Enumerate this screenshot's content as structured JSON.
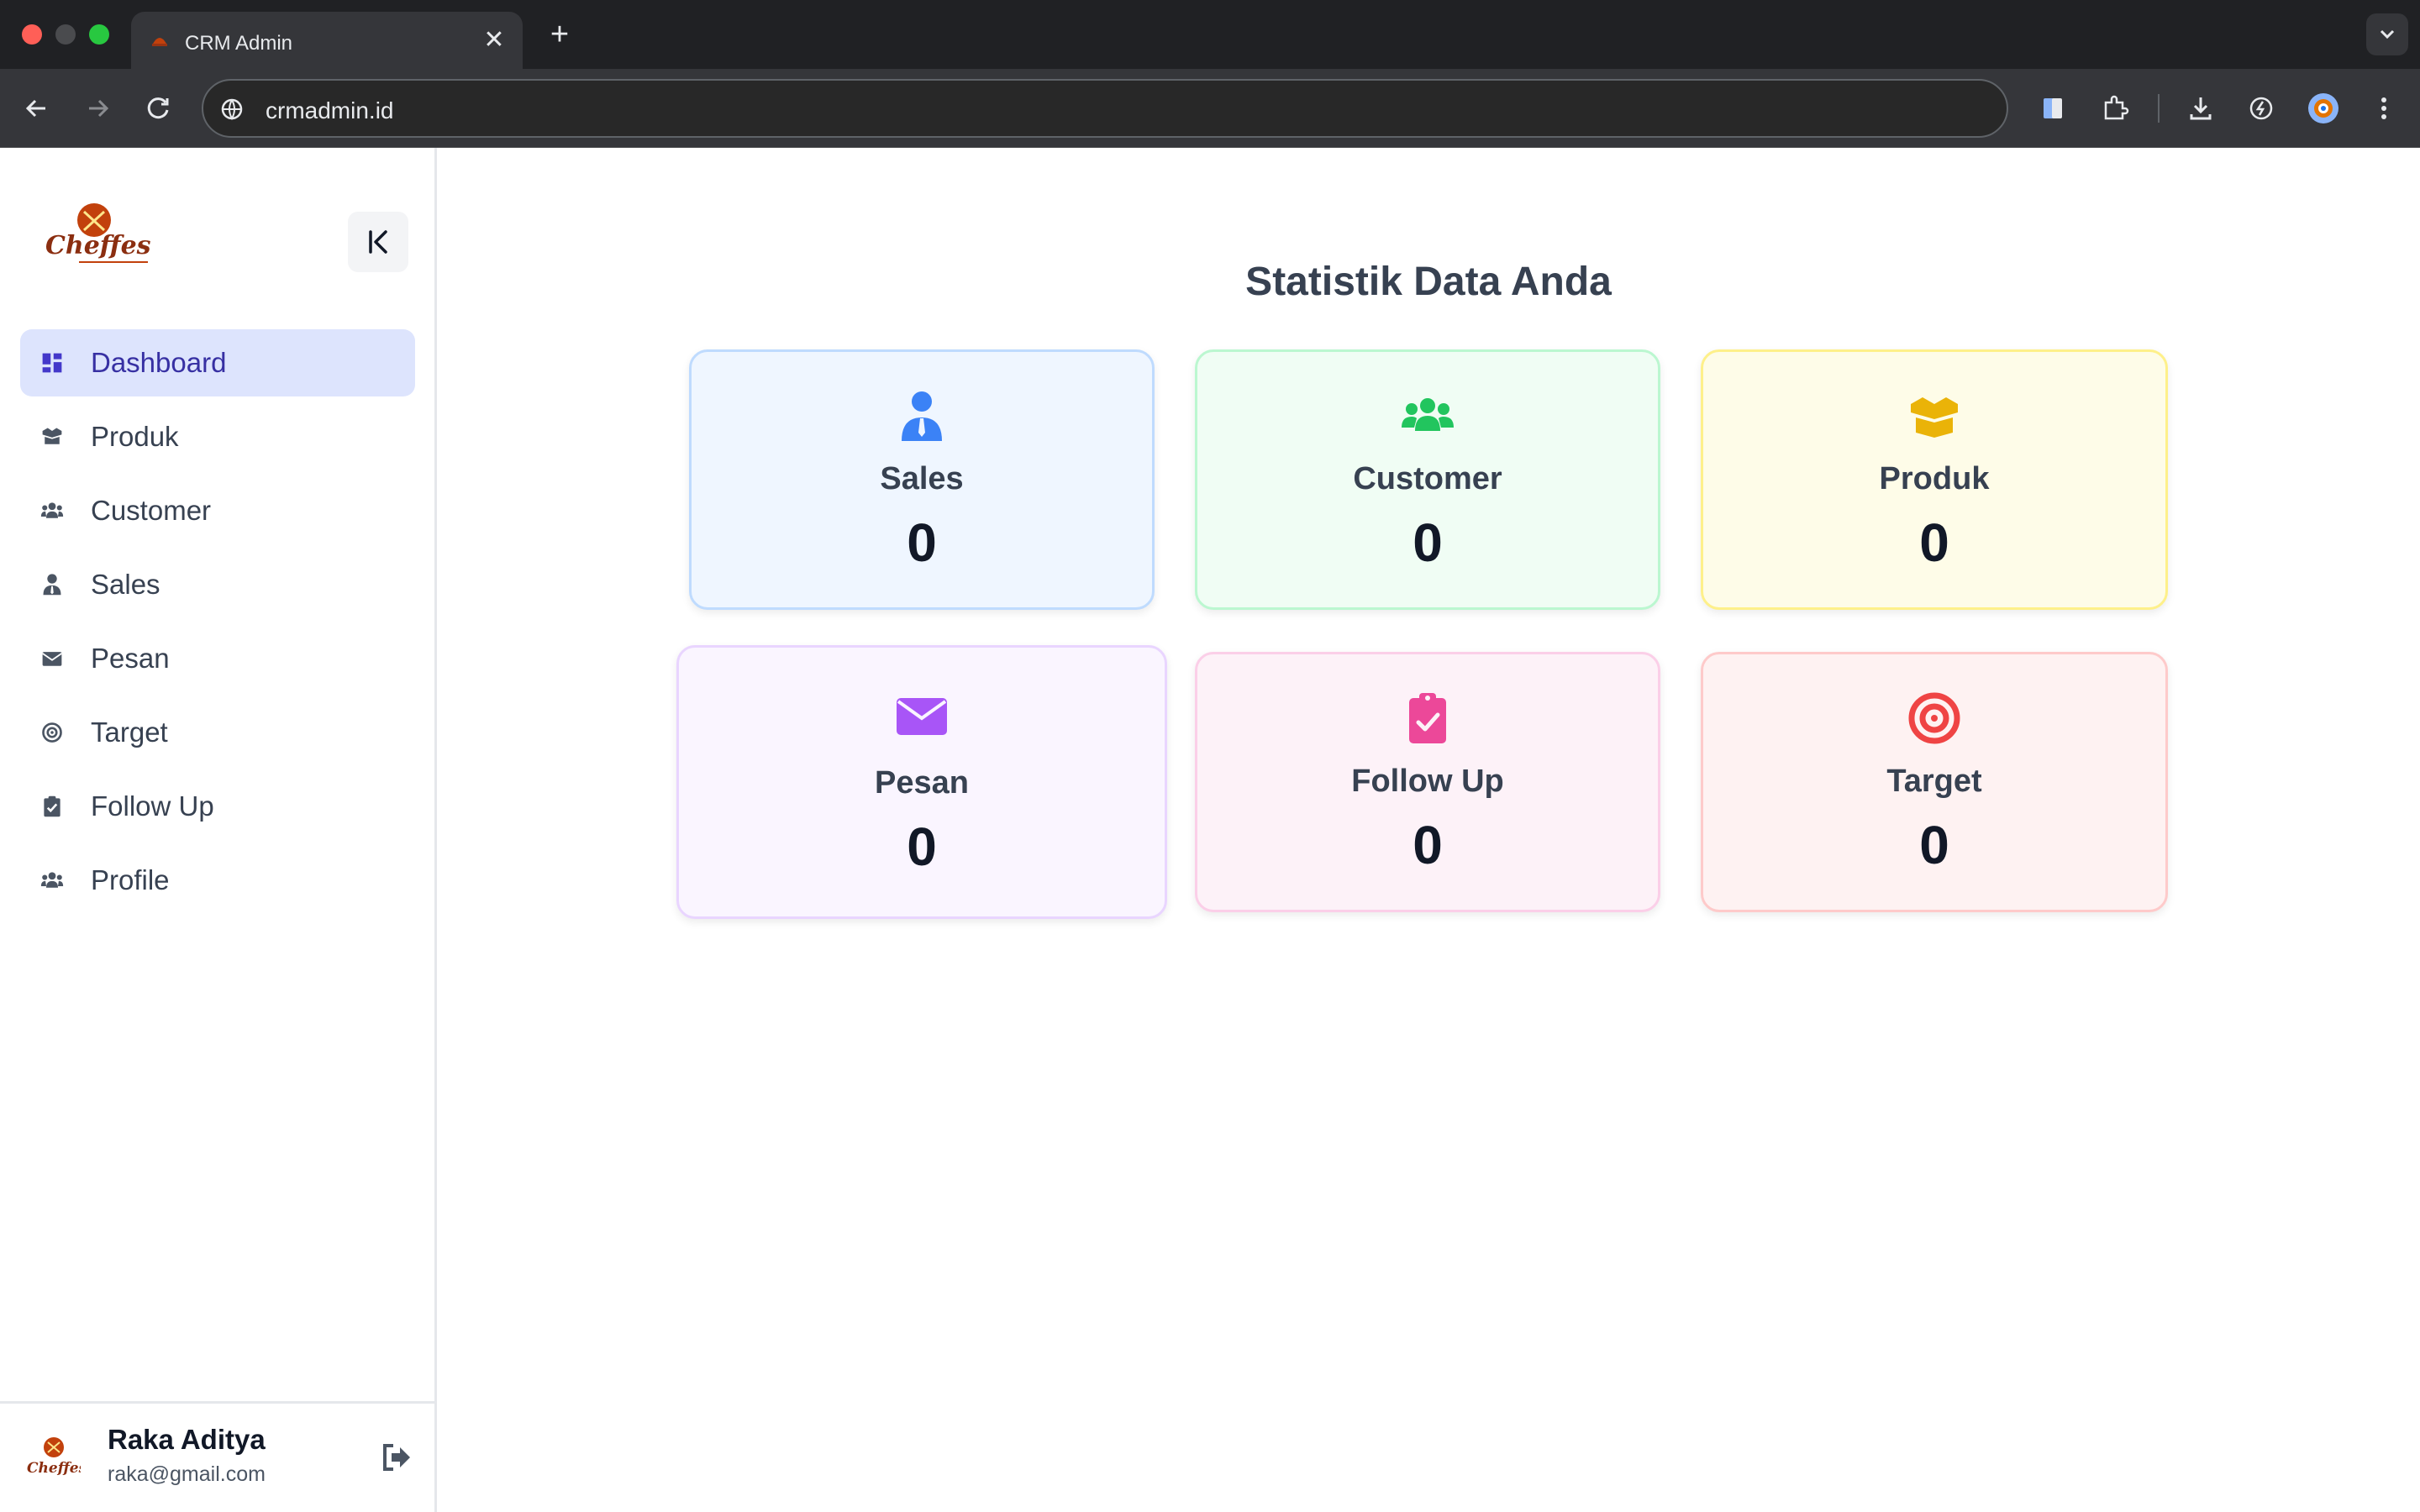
{
  "browser": {
    "tab_title": "CRM Admin",
    "url": "crmadmin.id"
  },
  "sidebar": {
    "logo_name": "cheffest-logo",
    "items": [
      {
        "label": "Dashboard",
        "icon": "dashboard-icon",
        "active": true
      },
      {
        "label": "Produk",
        "icon": "box-icon"
      },
      {
        "label": "Customer",
        "icon": "users-icon"
      },
      {
        "label": "Sales",
        "icon": "user-tie-icon"
      },
      {
        "label": "Pesan",
        "icon": "envelope-icon"
      },
      {
        "label": "Target",
        "icon": "target-icon"
      },
      {
        "label": "Follow Up",
        "icon": "clipboard-check-icon"
      },
      {
        "label": "Profile",
        "icon": "users-icon"
      }
    ]
  },
  "user": {
    "name": "Raka Aditya",
    "email": "raka@gmail.com"
  },
  "main": {
    "title": "Statistik Data Anda",
    "cards": [
      {
        "label": "Sales",
        "value": "0",
        "icon": "user-tie-icon",
        "color": "#3b82f6"
      },
      {
        "label": "Customer",
        "value": "0",
        "icon": "users-icon",
        "color": "#22c55e"
      },
      {
        "label": "Produk",
        "value": "0",
        "icon": "box-open-icon",
        "color": "#eab308"
      },
      {
        "label": "Pesan",
        "value": "0",
        "icon": "envelope-icon",
        "color": "#a855f7"
      },
      {
        "label": "Follow Up",
        "value": "0",
        "icon": "clipboard-check-icon",
        "color": "#ec4899"
      },
      {
        "label": "Target",
        "value": "0",
        "icon": "target-icon",
        "color": "#ef4444"
      }
    ]
  },
  "colors": {
    "active_nav_bg": "#dde4fd",
    "active_nav_text": "#3730a3",
    "brand": "#8b2e10"
  }
}
